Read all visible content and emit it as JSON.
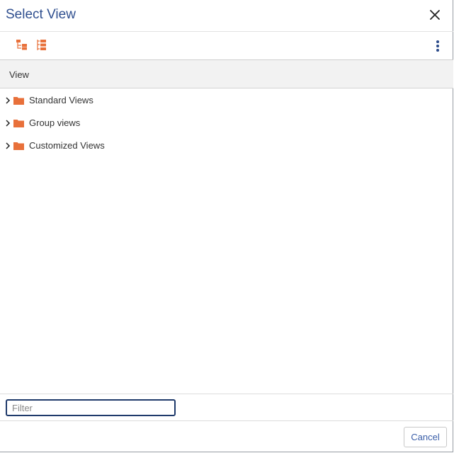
{
  "dialog": {
    "title": "Select View",
    "close_icon": "close-icon"
  },
  "toolbar": {
    "icons": [
      "expand-tree-icon",
      "collapse-tree-icon",
      "more-vertical-icon"
    ]
  },
  "column": {
    "header": "View"
  },
  "tree": {
    "items": [
      {
        "label": "Standard Views",
        "icon": "folder-icon",
        "expanded": false
      },
      {
        "label": "Group views",
        "icon": "folder-icon",
        "expanded": false
      },
      {
        "label": "Customized Views",
        "icon": "folder-icon",
        "expanded": false
      }
    ]
  },
  "filter": {
    "placeholder": "Filter",
    "value": ""
  },
  "footer": {
    "cancel_label": "Cancel"
  },
  "colors": {
    "title": "#2f4f8f",
    "accent_orange": "#e8703a",
    "kebab": "#2a4a8a",
    "filter_border": "#1f3a6b"
  }
}
